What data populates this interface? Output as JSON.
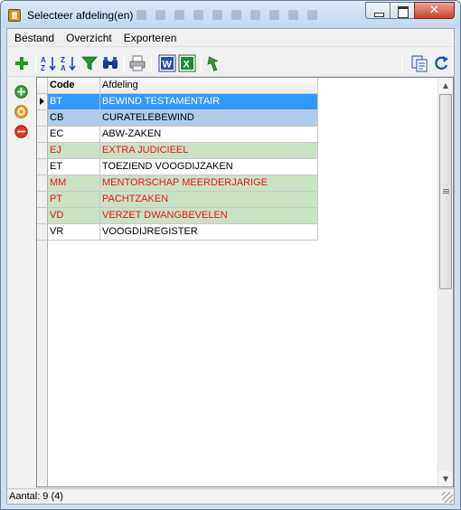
{
  "window": {
    "title": "Selecteer afdeling(en)"
  },
  "menu": {
    "items": [
      "Bestand",
      "Overzicht",
      "Exporteren"
    ]
  },
  "toolbar": {
    "icons": [
      "add-icon",
      "sort-ascending-icon",
      "sort-descending-icon",
      "filter-icon",
      "find-icon",
      "print-icon",
      "word-export-icon",
      "excel-export-icon",
      "select-return-icon",
      "copy-icon",
      "refresh-icon"
    ]
  },
  "side_actions": {
    "icons": [
      "add-circle-icon",
      "edit-circle-icon",
      "delete-circle-icon"
    ]
  },
  "grid": {
    "columns": [
      "Code",
      "Afdeling"
    ],
    "rows": [
      {
        "code": "BT",
        "afdeling": "BEWIND TESTAMENTAIR",
        "style": "selected"
      },
      {
        "code": "CB",
        "afdeling": "CURATELEBEWIND",
        "style": "highlight"
      },
      {
        "code": "EC",
        "afdeling": "ABW-ZAKEN",
        "style": "normal"
      },
      {
        "code": "EJ",
        "afdeling": "EXTRA JUDICIEEL",
        "style": "inactive"
      },
      {
        "code": "ET",
        "afdeling": "TOEZIEND VOOGDIJZAKEN",
        "style": "normal"
      },
      {
        "code": "MM",
        "afdeling": "MENTORSCHAP MEERDERJARIGE",
        "style": "inactive"
      },
      {
        "code": "PT",
        "afdeling": "PACHTZAKEN",
        "style": "inactive"
      },
      {
        "code": "VD",
        "afdeling": "VERZET DWANGBEVELEN",
        "style": "inactive"
      },
      {
        "code": "VR",
        "afdeling": "VOOGDIJREGISTER",
        "style": "normal"
      }
    ]
  },
  "colors": {
    "selected_bg": "#3399ff",
    "selected_fg": "#ffffff",
    "highlight_bg": "#aecbeb",
    "inactive_bg": "#c8e2c2",
    "inactive_fg": "#e8190d",
    "normal_bg": "#ffffff",
    "normal_fg": "#000000"
  },
  "status": {
    "text": "Aantal: 9 (4)"
  }
}
